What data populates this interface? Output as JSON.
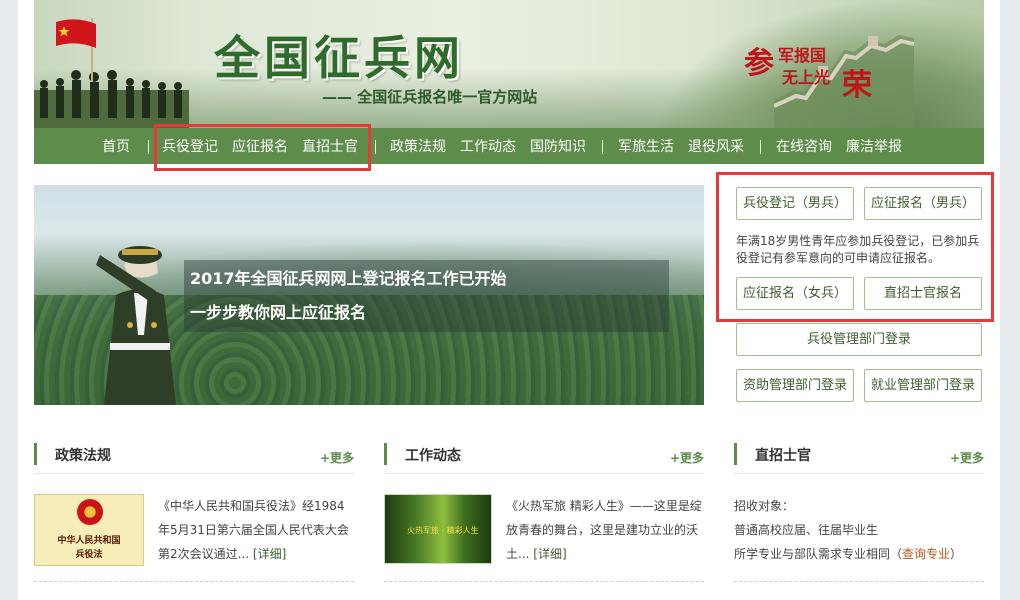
{
  "header": {
    "title": "全国征兵网",
    "subtitle": "—— 全国征兵报名唯一官方网站",
    "slogan": {
      "big1": "参",
      "line1": "军报国",
      "line2": "无上光",
      "big2": "荣"
    }
  },
  "nav": {
    "items": [
      "首页",
      "兵役登记",
      "应征报名",
      "直招士官",
      "政策法规",
      "工作动态",
      "国防知识",
      "军旅生活",
      "退役风采",
      "在线咨询",
      "廉洁举报"
    ]
  },
  "banner": {
    "line1": "2017年全国征兵网网上登记报名工作已开始",
    "line2": "一步步教你网上应征报名"
  },
  "right_panel": {
    "btn_register_male": "兵役登记（男兵）",
    "btn_apply_male": "应征报名（男兵）",
    "description": "年满18岁男性青年应参加兵役登记，已参加兵役登记有参军意向的可申请应征报名。",
    "btn_apply_female": "应征报名（女兵）",
    "btn_nco": "直招士官报名",
    "btn_admin_login": "兵役管理部门登录",
    "btn_aid_login": "资助管理部门登录",
    "btn_employ_login": "就业管理部门登录"
  },
  "sections": {
    "policy": {
      "title": "政策法规",
      "more": "+更多",
      "thumb_line1": "中华人民共和国",
      "thumb_line2": "兵役法",
      "text": "《中华人民共和国兵役法》经1984年5月31日第六届全国人民代表大会第2次会议通过...",
      "detail": "[详细]"
    },
    "work": {
      "title": "工作动态",
      "more": "+更多",
      "thumb_text": "火热军旅 · 精彩人生",
      "text": "《火热军旅 精彩人生》——这里是绽放青春的舞台，这里是建功立业的沃土...",
      "detail": "[详细]"
    },
    "nco": {
      "title": "直招士官",
      "more": "+更多",
      "line1": "招收对象：",
      "line2": "普通高校应届、往届毕业生",
      "line3_prefix": "所学专业与部队需求专业相同（",
      "line3_link": "查询专业",
      "line3_suffix": "）"
    }
  },
  "colors": {
    "nav_green": "#5e8c4a",
    "highlight_red": "#e8393a",
    "title_green": "#2f6b2a",
    "slogan_red": "#c0141a"
  }
}
